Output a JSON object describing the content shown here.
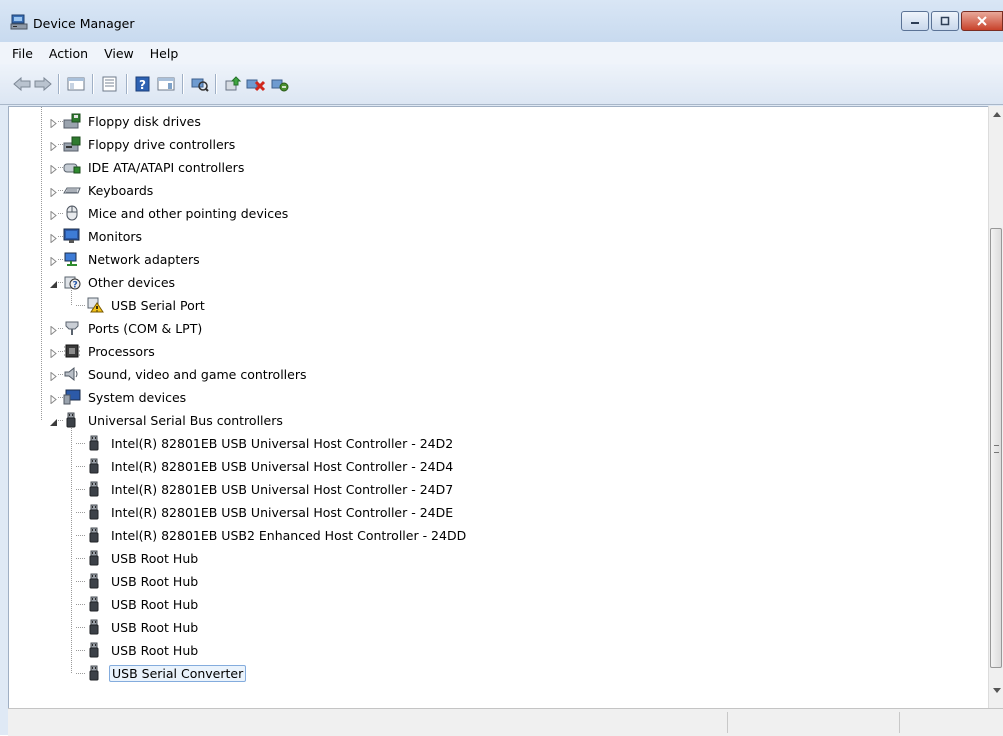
{
  "window": {
    "title": "Device Manager"
  },
  "menu": [
    "File",
    "Action",
    "View",
    "Help"
  ],
  "toolbar": {
    "buttons": [
      "back-icon",
      "forward-icon",
      "properties-console-icon",
      "properties-icon",
      "help-icon",
      "action-pane-icon",
      "scan-hardware-icon",
      "update-driver-icon",
      "disable-device-icon",
      "uninstall-device-icon"
    ]
  },
  "tree": [
    {
      "label": "Floppy disk drives",
      "level": 0,
      "state": "collapsed",
      "icon": "floppy-disk-icon"
    },
    {
      "label": "Floppy drive controllers",
      "level": 0,
      "state": "collapsed",
      "icon": "floppy-controller-icon"
    },
    {
      "label": "IDE ATA/ATAPI controllers",
      "level": 0,
      "state": "collapsed",
      "icon": "ide-controller-icon"
    },
    {
      "label": "Keyboards",
      "level": 0,
      "state": "collapsed",
      "icon": "keyboard-icon"
    },
    {
      "label": "Mice and other pointing devices",
      "level": 0,
      "state": "collapsed",
      "icon": "mouse-icon"
    },
    {
      "label": "Monitors",
      "level": 0,
      "state": "collapsed",
      "icon": "monitor-icon"
    },
    {
      "label": "Network adapters",
      "level": 0,
      "state": "collapsed",
      "icon": "network-adapter-icon"
    },
    {
      "label": "Other devices",
      "level": 0,
      "state": "expanded",
      "icon": "unknown-device-icon"
    },
    {
      "label": "USB Serial Port",
      "level": 1,
      "state": "leaf",
      "icon": "warning-device-icon"
    },
    {
      "label": "Ports (COM & LPT)",
      "level": 0,
      "state": "collapsed",
      "icon": "port-icon"
    },
    {
      "label": "Processors",
      "level": 0,
      "state": "collapsed",
      "icon": "processor-icon"
    },
    {
      "label": "Sound, video and game controllers",
      "level": 0,
      "state": "collapsed",
      "icon": "speaker-icon"
    },
    {
      "label": "System devices",
      "level": 0,
      "state": "collapsed",
      "icon": "system-devices-icon"
    },
    {
      "label": "Universal Serial Bus controllers",
      "level": 0,
      "state": "expanded",
      "icon": "usb-icon"
    },
    {
      "label": "Intel(R) 82801EB USB Universal Host Controller - 24D2",
      "level": 1,
      "state": "leaf",
      "icon": "usb-icon"
    },
    {
      "label": "Intel(R) 82801EB USB Universal Host Controller - 24D4",
      "level": 1,
      "state": "leaf",
      "icon": "usb-icon"
    },
    {
      "label": "Intel(R) 82801EB USB Universal Host Controller - 24D7",
      "level": 1,
      "state": "leaf",
      "icon": "usb-icon"
    },
    {
      "label": "Intel(R) 82801EB USB Universal Host Controller - 24DE",
      "level": 1,
      "state": "leaf",
      "icon": "usb-icon"
    },
    {
      "label": "Intel(R) 82801EB USB2 Enhanced Host Controller - 24DD",
      "level": 1,
      "state": "leaf",
      "icon": "usb-icon"
    },
    {
      "label": "USB Root Hub",
      "level": 1,
      "state": "leaf",
      "icon": "usb-icon"
    },
    {
      "label": "USB Root Hub",
      "level": 1,
      "state": "leaf",
      "icon": "usb-icon"
    },
    {
      "label": "USB Root Hub",
      "level": 1,
      "state": "leaf",
      "icon": "usb-icon"
    },
    {
      "label": "USB Root Hub",
      "level": 1,
      "state": "leaf",
      "icon": "usb-icon"
    },
    {
      "label": "USB Root Hub",
      "level": 1,
      "state": "leaf",
      "icon": "usb-icon"
    },
    {
      "label": "USB Serial Converter",
      "level": 1,
      "state": "leaf",
      "icon": "usb-icon",
      "selected": true
    }
  ],
  "statusbar": {
    "text": ""
  }
}
